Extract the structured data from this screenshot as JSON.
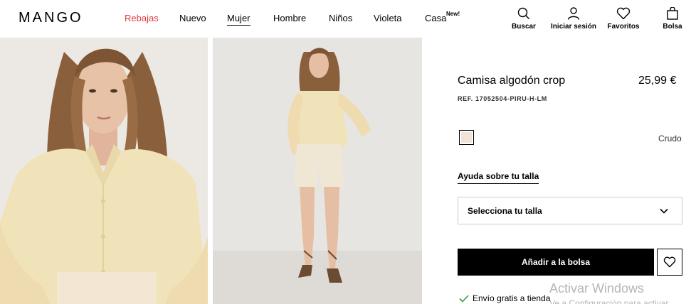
{
  "header": {
    "logo": "MANGO",
    "nav": [
      {
        "label": "Rebajas",
        "sale": true
      },
      {
        "label": "Nuevo"
      },
      {
        "label": "Mujer",
        "active": true
      },
      {
        "label": "Hombre"
      },
      {
        "label": "Niños"
      },
      {
        "label": "Violeta"
      },
      {
        "label": "Casa",
        "badge": "New!"
      }
    ],
    "actions": {
      "search": "Buscar",
      "login": "Iniciar sesión",
      "favorites": "Favoritos",
      "bag": "Bolsa"
    }
  },
  "product": {
    "title": "Camisa algodón crop",
    "price": "25,99 €",
    "ref": "REF. 17052504-PIRU-H-LM",
    "color_name": "Crudo",
    "swatch_color": "#efe4d6",
    "size_help": "Ayuda sobre tu talla",
    "size_select_placeholder": "Selecciona tu talla",
    "add_to_bag": "Añadir a la bolsa",
    "shipping": "Envío gratis a tienda"
  },
  "colors": {
    "sale": "#e03a3e",
    "primary": "#000000"
  },
  "watermark": {
    "line1": "Activar Windows",
    "line2": "Ve a Configuración para activar"
  }
}
